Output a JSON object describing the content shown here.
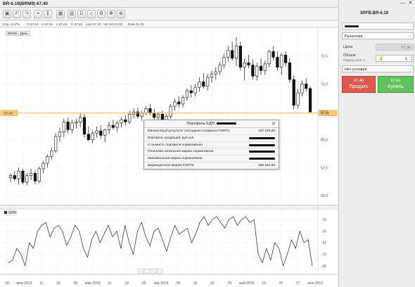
{
  "window": {
    "title": "BR-6.19(BRM9) 67,40"
  },
  "toolbar": {
    "buttons": [
      "chart-type-icon",
      "undo-icon",
      "redo-icon",
      "list-icon",
      "candles-icon",
      "grid-icon",
      "bar-chart-icon",
      "cursor-icon",
      "draw-icon",
      "settings-icon",
      "move-icon",
      "zoom-in-icon"
    ]
  },
  "infobar": {
    "chg": "Chg -0,37%",
    "open": "O 67,64",
    "high": "H 67,54",
    "low": "L 67,28",
    "close": "C 67,65",
    "last": "Last 67,40",
    "vol": "Vol 18190,00",
    "date": "Date 21.05"
  },
  "chart": {
    "legend": "BRM9 - День",
    "current_price_label": "67,40",
    "accent_color": "#ffb347",
    "indicator_label": "WPR",
    "x_labels": [
      "28",
      "фев 2019",
      "11",
      "18",
      "25",
      "мар 2019",
      "11",
      "18",
      "25",
      "апр 2019",
      "08",
      "15",
      "22",
      "29",
      "май 2019",
      "13",
      "20",
      "27",
      "июн 2019"
    ],
    "price_ticks": [
      "72,5",
      "70,0",
      "67,5",
      "65,0",
      "62,5",
      "60,0"
    ],
    "wpr_ticks": [
      "-10",
      "-30",
      "-50",
      "-70",
      "-90"
    ]
  },
  "chart_data": {
    "type": "candlestick",
    "ylim": [
      59.5,
      74.5
    ],
    "price_ticks": [
      72.5,
      70.0,
      67.5,
      65.0,
      62.5,
      60.0
    ],
    "candles": [
      [
        61.6,
        62.0,
        61.2,
        61.8
      ],
      [
        61.8,
        62.2,
        61.3,
        61.5
      ],
      [
        61.5,
        62.5,
        61.0,
        62.2
      ],
      [
        62.2,
        62.4,
        61.0,
        61.2
      ],
      [
        61.2,
        62.0,
        60.9,
        61.8
      ],
      [
        61.8,
        62.4,
        61.4,
        62.0
      ],
      [
        62.0,
        62.3,
        61.0,
        61.3
      ],
      [
        61.3,
        62.6,
        61.1,
        62.4
      ],
      [
        62.4,
        63.1,
        62.0,
        62.9
      ],
      [
        62.9,
        63.7,
        62.5,
        63.5
      ],
      [
        63.5,
        64.3,
        63.2,
        64.0
      ],
      [
        64.0,
        65.6,
        63.8,
        65.3
      ],
      [
        65.3,
        66.1,
        64.8,
        65.7
      ],
      [
        65.7,
        66.9,
        65.2,
        66.6
      ],
      [
        66.6,
        67.0,
        65.6,
        65.9
      ],
      [
        65.9,
        66.8,
        65.6,
        66.5
      ],
      [
        66.5,
        66.9,
        66.0,
        66.6
      ],
      [
        66.6,
        67.4,
        66.1,
        67.0
      ],
      [
        67.0,
        67.3,
        65.2,
        65.5
      ],
      [
        65.5,
        66.2,
        64.9,
        65.0
      ],
      [
        65.0,
        65.9,
        64.7,
        65.6
      ],
      [
        65.6,
        66.2,
        65.2,
        65.8
      ],
      [
        65.8,
        66.3,
        65.1,
        65.4
      ],
      [
        65.4,
        66.0,
        64.8,
        65.9
      ],
      [
        65.9,
        66.6,
        65.5,
        66.3
      ],
      [
        66.3,
        66.8,
        65.9,
        66.1
      ],
      [
        66.1,
        66.7,
        65.7,
        66.5
      ],
      [
        66.5,
        67.0,
        66.1,
        66.8
      ],
      [
        66.8,
        67.2,
        66.3,
        66.6
      ],
      [
        66.6,
        67.6,
        66.4,
        67.3
      ],
      [
        67.3,
        67.8,
        66.9,
        67.5
      ],
      [
        67.5,
        67.9,
        66.9,
        67.1
      ],
      [
        67.1,
        67.6,
        66.7,
        67.4
      ],
      [
        67.4,
        68.0,
        67.2,
        67.8
      ],
      [
        67.8,
        68.2,
        67.2,
        67.4
      ],
      [
        67.4,
        67.8,
        66.8,
        67.0
      ],
      [
        67.0,
        67.5,
        66.6,
        67.3
      ],
      [
        67.3,
        67.6,
        66.5,
        66.8
      ],
      [
        66.8,
        67.3,
        66.4,
        67.1
      ],
      [
        67.1,
        68.2,
        66.9,
        68.0
      ],
      [
        68.0,
        68.7,
        67.6,
        68.4
      ],
      [
        68.4,
        68.9,
        67.9,
        68.2
      ],
      [
        68.2,
        69.0,
        67.9,
        68.8
      ],
      [
        68.8,
        69.6,
        68.5,
        69.4
      ],
      [
        69.4,
        69.9,
        68.8,
        69.2
      ],
      [
        69.2,
        70.0,
        68.9,
        69.7
      ],
      [
        69.7,
        70.6,
        69.3,
        70.2
      ],
      [
        70.2,
        71.0,
        69.6,
        69.8
      ],
      [
        69.8,
        70.9,
        69.4,
        70.6
      ],
      [
        70.6,
        71.2,
        70.1,
        70.9
      ],
      [
        70.9,
        71.5,
        70.4,
        71.1
      ],
      [
        71.1,
        72.0,
        70.8,
        71.7
      ],
      [
        71.7,
        72.7,
        71.4,
        72.4
      ],
      [
        72.4,
        73.4,
        72.0,
        73.0
      ],
      [
        73.0,
        73.8,
        72.1,
        72.3
      ],
      [
        72.3,
        74.2,
        71.6,
        73.4
      ],
      [
        73.4,
        73.8,
        71.2,
        71.5
      ],
      [
        71.5,
        72.3,
        70.3,
        71.9
      ],
      [
        71.9,
        72.6,
        71.4,
        71.7
      ],
      [
        71.7,
        72.2,
        70.4,
        70.7
      ],
      [
        70.7,
        71.9,
        70.3,
        71.6
      ],
      [
        71.6,
        72.3,
        70.8,
        71.2
      ],
      [
        71.2,
        72.1,
        70.8,
        71.8
      ],
      [
        71.8,
        73.1,
        71.5,
        72.9
      ],
      [
        72.9,
        73.4,
        72.1,
        72.4
      ],
      [
        72.4,
        72.9,
        71.2,
        71.5
      ],
      [
        71.5,
        72.8,
        70.8,
        72.6
      ],
      [
        72.6,
        72.9,
        71.6,
        71.9
      ],
      [
        71.9,
        72.3,
        70.1,
        70.4
      ],
      [
        70.4,
        70.8,
        67.7,
        68.1
      ],
      [
        68.1,
        69.6,
        67.8,
        69.2
      ],
      [
        69.2,
        70.3,
        68.9,
        70.0
      ],
      [
        70.0,
        70.5,
        69.3,
        69.6
      ],
      [
        69.6,
        69.8,
        67.4,
        67.5
      ]
    ],
    "wpr_values": [
      -85,
      -80,
      -60,
      -70,
      -90,
      -50,
      -60,
      -30,
      -20,
      -15,
      -40,
      -25,
      -20,
      -30,
      -55,
      -40,
      -20,
      -30,
      -60,
      -75,
      -45,
      -30,
      -50,
      -35,
      -20,
      -40,
      -30,
      -60,
      -20,
      -50,
      -70,
      -30,
      -15,
      -40,
      -55,
      -30,
      -25,
      -45,
      -65,
      -40,
      -20,
      -35,
      -30,
      -25,
      -50,
      -35,
      -15,
      -5,
      -20,
      -10,
      -5,
      -15,
      -25,
      -10,
      -5,
      -20,
      -10,
      -5,
      -15,
      -10,
      -70,
      -85,
      -60,
      -80,
      -50,
      -60,
      -90,
      -70,
      -45,
      -60,
      -30,
      -50,
      -45,
      -90
    ]
  },
  "portfolio": {
    "title": "Портфель ЕДП:",
    "rows": [
      {
        "label": "Финансовый результат последнего клиринга FORTS",
        "value": "167 229,00"
      },
      {
        "label": "Портфель входящий, руб.коп",
        "value": ""
      },
      {
        "label": "Стоимость портфеля нормативная",
        "value": ""
      },
      {
        "label": "Плановая начальная маржа нормативная",
        "value": ""
      },
      {
        "label": "Минимальная маржа нормативная",
        "value": ""
      },
      {
        "label": "Вариационная маржа FORTS",
        "value": "180 552,60"
      }
    ]
  },
  "order_panel": {
    "title": "SPFB.BR-6.19",
    "account_select": "",
    "order_type": "Рыночная",
    "price_label": "Цена",
    "price_value": "67,38",
    "volume_label": "Объем",
    "lot_size_label": "Размер лота: 1",
    "volume_value": "1",
    "condition": "Нет условия",
    "sell_price": "67,40",
    "sell_label": "Продать",
    "buy_price": "67,41",
    "buy_label": "Купить"
  },
  "colors": {
    "sell": "#d95a4e",
    "buy": "#63c15e",
    "price_line": "#ffb347"
  }
}
